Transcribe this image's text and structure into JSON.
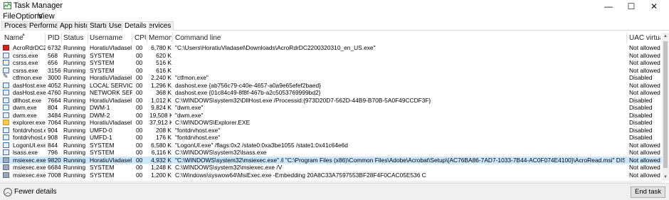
{
  "window": {
    "title": "Task Manager",
    "app_icon": "task-manager-icon",
    "controls": {
      "minimize": "—",
      "maximize": "☐",
      "close": "✕"
    }
  },
  "menu": [
    "File",
    "Options",
    "View"
  ],
  "tabs": [
    {
      "label": "Processes",
      "active": false
    },
    {
      "label": "Performance",
      "active": false
    },
    {
      "label": "App history",
      "active": false
    },
    {
      "label": "Startup",
      "active": false
    },
    {
      "label": "Users",
      "active": false
    },
    {
      "label": "Details",
      "active": true
    },
    {
      "label": "Services",
      "active": false
    }
  ],
  "columns": [
    "Name",
    "PID",
    "Status",
    "Username",
    "CPU",
    "Memory...",
    "Command line",
    "UAC virtual..."
  ],
  "rows": [
    {
      "icon": "acrobat-icon",
      "name": "AcroRdrDC220...",
      "pid": "6732",
      "status": "Running",
      "user": "HoratiuVladasel",
      "cpu": "00",
      "mem": "6,780 K",
      "cmd": "\"C:\\Users\\HoratiuVladasel\\Downloads\\AcroRdrDC2200320310_en_US.exe\"",
      "uac": "Not allowed"
    },
    {
      "icon": "system-process-icon",
      "name": "csrss.exe",
      "pid": "568",
      "status": "Running",
      "user": "SYSTEM",
      "cpu": "00",
      "mem": "620 K",
      "cmd": "",
      "uac": "Not allowed"
    },
    {
      "icon": "system-process-icon",
      "name": "csrss.exe",
      "pid": "656",
      "status": "Running",
      "user": "SYSTEM",
      "cpu": "00",
      "mem": "516 K",
      "cmd": "",
      "uac": "Not allowed"
    },
    {
      "icon": "system-process-icon",
      "name": "csrss.exe",
      "pid": "3156",
      "status": "Running",
      "user": "SYSTEM",
      "cpu": "00",
      "mem": "616 K",
      "cmd": "",
      "uac": "Not allowed"
    },
    {
      "icon": "ctf-loader-icon",
      "name": "ctfmon.exe",
      "pid": "3000",
      "status": "Running",
      "user": "HoratiuVladasel",
      "cpu": "00",
      "mem": "2,240 K",
      "cmd": "\"ctfmon.exe\"",
      "uac": "Disabled"
    },
    {
      "icon": "system-process-icon",
      "name": "dasHost.exe",
      "pid": "4052",
      "status": "Running",
      "user": "LOCAL SERVICE",
      "cpu": "00",
      "mem": "1,296 K",
      "cmd": "dashost.exe {ab756c79-c40e-4657-a0a9e65efef2baed}",
      "uac": "Not allowed"
    },
    {
      "icon": "system-process-icon",
      "name": "dasHost.exe",
      "pid": "4760",
      "status": "Running",
      "user": "NETWORK SER...",
      "cpu": "00",
      "mem": "368 K",
      "cmd": "dashost.exe {01c84c49-8f8f-467b-a2c5053769999bd2}",
      "uac": "Not allowed"
    },
    {
      "icon": "system-process-icon",
      "name": "dllhost.exe",
      "pid": "7664",
      "status": "Running",
      "user": "HoratiuVladasel",
      "cpu": "00",
      "mem": "1,012 K",
      "cmd": "C:\\WINDOWS\\system32\\DllHost.exe /Processid:{973D20D7-562D-44B9-B70B-5A0F49CCDF3F}",
      "uac": "Disabled"
    },
    {
      "icon": "system-process-icon",
      "name": "dwm.exe",
      "pid": "804",
      "status": "Running",
      "user": "DWM-1",
      "cpu": "00",
      "mem": "9,824 K",
      "cmd": "\"dwm.exe\"",
      "uac": "Disabled"
    },
    {
      "icon": "system-process-icon",
      "name": "dwm.exe",
      "pid": "3484",
      "status": "Running",
      "user": "DWM-2",
      "cpu": "00",
      "mem": "19,508 K",
      "cmd": "\"dwm.exe\"",
      "uac": "Disabled"
    },
    {
      "icon": "explorer-icon",
      "name": "explorer.exe",
      "pid": "7064",
      "status": "Running",
      "user": "HoratiuVladasel",
      "cpu": "00",
      "mem": "37,912 K",
      "cmd": "C:\\WINDOWS\\Explorer.EXE",
      "uac": "Disabled"
    },
    {
      "icon": "system-process-icon",
      "name": "fontdrvhost.exe",
      "pid": "904",
      "status": "Running",
      "user": "UMFD-0",
      "cpu": "00",
      "mem": "208 K",
      "cmd": "\"fontdrvhost.exe\"",
      "uac": "Disabled"
    },
    {
      "icon": "system-process-icon",
      "name": "fontdrvhost.exe",
      "pid": "908",
      "status": "Running",
      "user": "UMFD-1",
      "cpu": "00",
      "mem": "176 K",
      "cmd": "\"fontdrvhost.exe\"",
      "uac": "Disabled"
    },
    {
      "icon": "system-process-icon",
      "name": "LogonUI.exe",
      "pid": "844",
      "status": "Running",
      "user": "SYSTEM",
      "cpu": "00",
      "mem": "6,580 K",
      "cmd": "\"LogonUI.exe\" /flags:0x2 /state0:0xa3be1055 /state1:0x41c64e6d",
      "uac": "Not allowed"
    },
    {
      "icon": "system-process-icon",
      "name": "lsass.exe",
      "pid": "796",
      "status": "Running",
      "user": "SYSTEM",
      "cpu": "00",
      "mem": "6,116 K",
      "cmd": "C:\\WINDOWS\\system32\\lsass.exe",
      "uac": "Not allowed"
    },
    {
      "icon": "installer-icon",
      "name": "msiexec.exe",
      "pid": "9820",
      "status": "Running",
      "user": "HoratiuVladasel",
      "cpu": "00",
      "mem": "4,932 K",
      "cmd": "\"C:\\WINDOWS\\system32\\msiexec.exe\" /i \"C:\\Program Files (x86)\\Common Files\\Adobe\\Acrobat\\Setup\\{AC76BA86-7AD7-1033-7B44-AC0F074E4100}\\AcroRead.msi\"  DISABLE_CACHE=1 REBOOT=\"ReallySuppress\" ...",
      "uac": "Not allowed",
      "selected": true
    },
    {
      "icon": "installer-icon",
      "name": "msiexec.exe",
      "pid": "6684",
      "status": "Running",
      "user": "SYSTEM",
      "cpu": "00",
      "mem": "1,248 K",
      "cmd": "C:\\WINDOWS\\system32\\msiexec.exe /V",
      "uac": "Not allowed"
    },
    {
      "icon": "installer-icon",
      "name": "msiexec.exe",
      "pid": "7008",
      "status": "Running",
      "user": "SYSTEM",
      "cpu": "00",
      "mem": "1,200 K",
      "cmd": "C:\\Windows\\syswow64\\MsiExec.exe -Embedding 20A8C33A7597553BF28F4F0CAC05E536 C",
      "uac": "Not allowed"
    }
  ],
  "footer": {
    "fewer_details": "Fewer details",
    "end_task": "End task"
  }
}
